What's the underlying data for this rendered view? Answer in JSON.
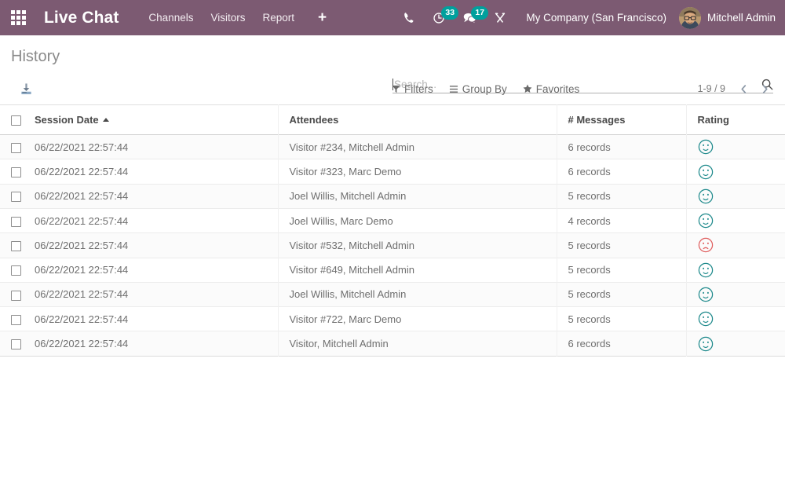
{
  "navbar": {
    "apps_icon": "apps-grid-icon",
    "brand": "Live Chat",
    "menu": [
      {
        "label": "Channels",
        "name": "nav-item-channels"
      },
      {
        "label": "Visitors",
        "name": "nav-item-visitors"
      },
      {
        "label": "Report",
        "name": "nav-item-report"
      }
    ],
    "plus_label": "+",
    "sys_icons": [
      {
        "name": "phone-icon",
        "badge": null
      },
      {
        "name": "activity-clock-icon",
        "badge": "33"
      },
      {
        "name": "messages-chat-icon",
        "badge": "17"
      },
      {
        "name": "tools-wrench-icon",
        "badge": null
      }
    ],
    "company": "My Company (San Francisco)",
    "user_name": "Mitchell Admin",
    "avatar_name": "user-avatar",
    "bg_color": "#7c5a72",
    "badge_color": "#00a09d"
  },
  "control_panel": {
    "title": "History",
    "search": {
      "placeholder": "Search...",
      "value": ""
    },
    "export_icon": "download-export-icon",
    "buttons": [
      {
        "label": "Filters",
        "icon": "filter-funnel-icon",
        "name": "filters-button"
      },
      {
        "label": "Group By",
        "icon": "group-by-bars-icon",
        "name": "group-by-button"
      },
      {
        "label": "Favorites",
        "icon": "favorites-star-icon",
        "name": "favorites-button"
      }
    ],
    "pager": {
      "count": "1-9 / 9",
      "prev_icon": "chevron-left-icon",
      "next_icon": "chevron-right-icon"
    }
  },
  "table": {
    "columns": [
      {
        "label": "Session Date",
        "sorted": "asc"
      },
      {
        "label": "Attendees",
        "sorted": null
      },
      {
        "label": "# Messages",
        "sorted": null
      },
      {
        "label": "Rating",
        "sorted": null
      }
    ],
    "rating_colors": {
      "happy": "#1f8a8c",
      "sad": "#e06060"
    },
    "rows": [
      {
        "date": "06/22/2021 22:57:44",
        "attendees": "Visitor #234, Mitchell Admin",
        "messages": "6 records",
        "rating": "happy"
      },
      {
        "date": "06/22/2021 22:57:44",
        "attendees": "Visitor #323, Marc Demo",
        "messages": "6 records",
        "rating": "happy"
      },
      {
        "date": "06/22/2021 22:57:44",
        "attendees": "Joel Willis, Mitchell Admin",
        "messages": "5 records",
        "rating": "happy"
      },
      {
        "date": "06/22/2021 22:57:44",
        "attendees": "Joel Willis, Marc Demo",
        "messages": "4 records",
        "rating": "happy"
      },
      {
        "date": "06/22/2021 22:57:44",
        "attendees": "Visitor #532, Mitchell Admin",
        "messages": "5 records",
        "rating": "sad"
      },
      {
        "date": "06/22/2021 22:57:44",
        "attendees": "Visitor #649, Mitchell Admin",
        "messages": "5 records",
        "rating": "happy"
      },
      {
        "date": "06/22/2021 22:57:44",
        "attendees": "Joel Willis, Mitchell Admin",
        "messages": "5 records",
        "rating": "happy"
      },
      {
        "date": "06/22/2021 22:57:44",
        "attendees": "Visitor #722, Marc Demo",
        "messages": "5 records",
        "rating": "happy"
      },
      {
        "date": "06/22/2021 22:57:44",
        "attendees": "Visitor, Mitchell Admin",
        "messages": "6 records",
        "rating": "happy"
      }
    ]
  }
}
